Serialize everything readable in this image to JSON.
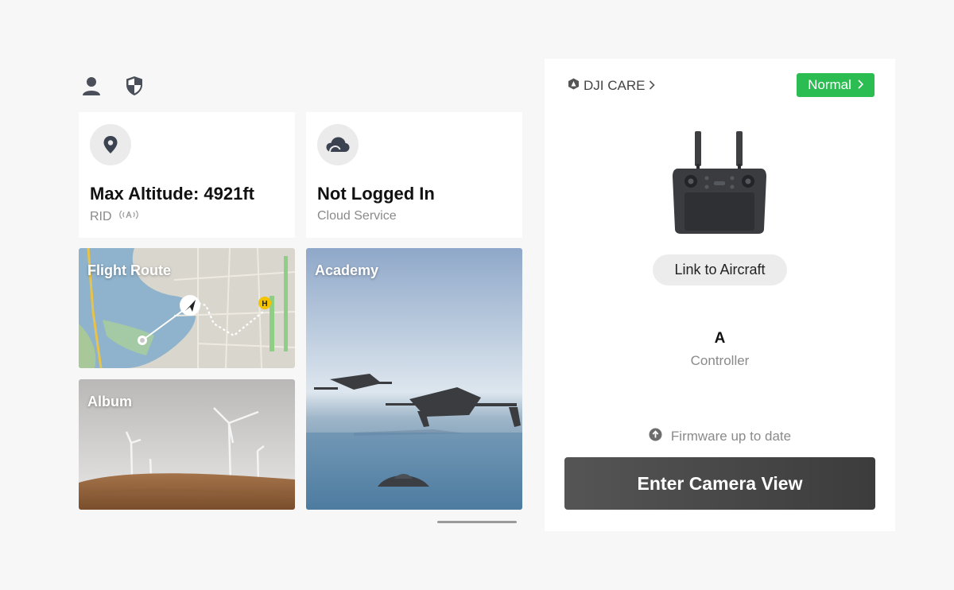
{
  "top_icons": [
    "person-icon",
    "shield-icon"
  ],
  "altitude_card": {
    "icon": "location-pin-icon",
    "title": "Max Altitude: 4921ft",
    "subtitle": "RID",
    "subtitle_icon": "remote-id-broadcast-icon"
  },
  "cloud_card": {
    "icon": "cloud-icon",
    "title": "Not Logged In",
    "subtitle": "Cloud Service"
  },
  "tiles": {
    "flight_route": "Flight Route",
    "album": "Album",
    "academy": "Academy"
  },
  "panel": {
    "care_label": "DJI CARE",
    "status": "Normal",
    "status_color": "#2bbd52",
    "link_button": "Link to Aircraft",
    "controller_letter": "A",
    "controller_label": "Controller",
    "firmware_status": "Firmware up to date",
    "enter_button": "Enter Camera View"
  }
}
